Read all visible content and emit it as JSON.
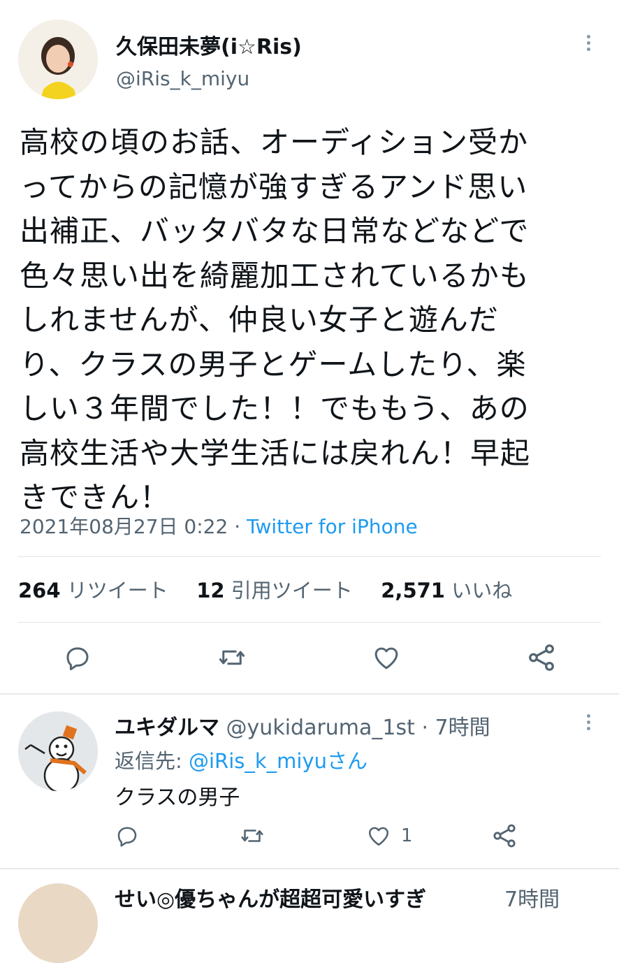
{
  "tweet": {
    "author_name": "久保田未夢(i☆Ris)",
    "handle": "@iRis_k_miyu",
    "text_lines": [
      "高校の頃のお話、オーディション受か",
      "ってからの記憶が強すぎるアンド思い",
      "出補正、バッタバタな日常などなどで",
      "色々思い出を綺麗加工されているかも",
      "しれませんが、仲良い女子と遊んだ",
      "り、クラスの男子とゲームしたり、楽",
      "しい３年間でした！！でももう、あの",
      "高校生活や大学生活には戻れん！早起",
      "きできん！"
    ],
    "timestamp": "2021年08月27日 0:22",
    "separator": "·",
    "source": "Twitter for iPhone",
    "stats": {
      "retweets_num": "264",
      "retweets_label": "リツイート",
      "quotes_num": "12",
      "quotes_label": "引用ツイート",
      "likes_num": "2,571",
      "likes_label": "いいね"
    }
  },
  "reply": {
    "author_name": "ユキダルマ",
    "handle": "@yukidaruma_1st",
    "separator": "·",
    "time": "7時間",
    "reply_to_prefix": "返信先:",
    "reply_to_handle": "@iRis_k_miyuさん",
    "text": "クラスの男子",
    "like_count": "1"
  },
  "next_reply": {
    "author_name_partial": "せい◎優ちゃんが超超可愛いすぎ",
    "time_partial": "7時間"
  },
  "colors": {
    "accent": "#1d9bf0",
    "muted": "#536471",
    "icon": "#536471",
    "divider": "#e1e5e9"
  },
  "icons": [
    "reply-icon",
    "retweet-icon",
    "like-icon",
    "share-icon",
    "more-icon"
  ]
}
